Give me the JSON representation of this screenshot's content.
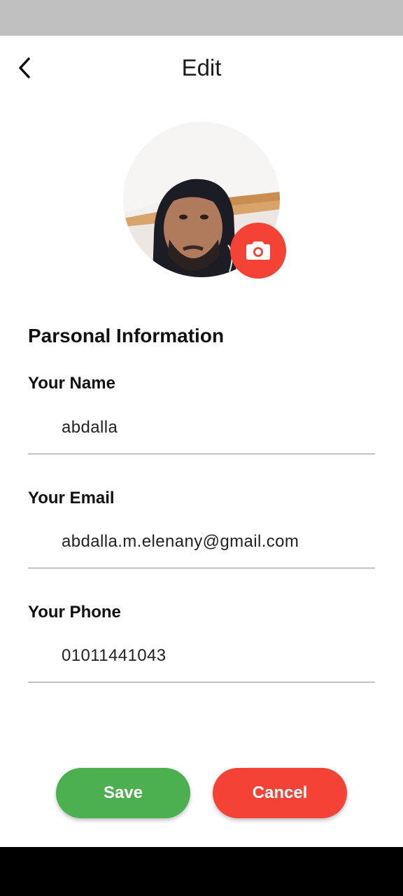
{
  "app_bar": {
    "title": "Edit",
    "back_icon": "chevron-left-icon"
  },
  "profile": {
    "camera_icon": "camera-icon",
    "accent_color": "#f44336"
  },
  "section": {
    "title": "Parsonal Information"
  },
  "fields": {
    "name": {
      "label": "Your Name",
      "value": "abdalla"
    },
    "email": {
      "label": "Your Email",
      "value": "abdalla.m.elenany@gmail.com"
    },
    "phone": {
      "label": "Your Phone",
      "value": "01011441043"
    }
  },
  "buttons": {
    "save_label": "Save",
    "save_color": "#4caf50",
    "cancel_label": "Cancel",
    "cancel_color": "#f44336"
  }
}
